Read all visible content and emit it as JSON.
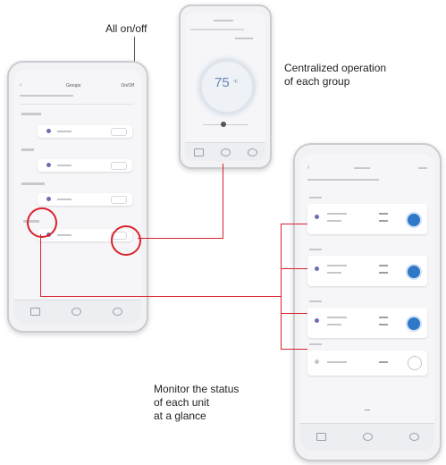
{
  "callouts": {
    "all_onoff": "All on/off",
    "centralized": [
      "Centralized operation",
      "of each group"
    ],
    "monitor": [
      "Monitor the status",
      "of each unit",
      "at a glance"
    ]
  },
  "colors": {
    "highlight": "#d9232e",
    "accent": "#2f78c8"
  },
  "phone_left": {
    "title": "Groups",
    "top_right": "On/Off",
    "back_icon": "chevron-left-icon",
    "tab_icons": [
      "home-icon",
      "schedule-icon",
      "settings-icon"
    ]
  },
  "phone_center": {
    "temperature": "75",
    "unit": "°F",
    "tab_icons": [
      "home-icon",
      "fan-icon",
      "settings-icon"
    ]
  },
  "phone_right": {
    "back_icon": "chevron-left-icon",
    "tab_icons": [
      "home-icon",
      "schedule-icon",
      "settings-icon"
    ]
  }
}
